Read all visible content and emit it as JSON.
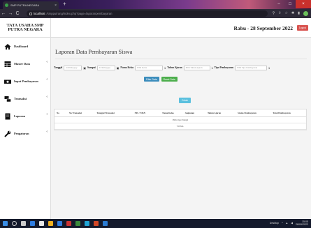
{
  "browser": {
    "tab_title": "SMP PUTRA NEGARA",
    "tab_close": "×",
    "new_tab": "+",
    "back": "←",
    "forward": "→",
    "reload": "C",
    "url_host": "localhost",
    "url_path": "/smpputrang/index.php?page=laporanpembayaran",
    "window_buttons": [
      "–",
      "□",
      "×"
    ]
  },
  "sidebar": {
    "brand": "TATA USAHA SMP PUTRA NEGARA",
    "items": [
      {
        "label": "Dashboard",
        "icon": "home-icon",
        "has_submenu": false
      },
      {
        "label": "Master Data",
        "icon": "table-icon",
        "has_submenu": true
      },
      {
        "label": "Input Pembayaran",
        "icon": "money-icon",
        "has_submenu": true
      },
      {
        "label": "Transaksi",
        "icon": "exchange-icon",
        "has_submenu": true
      },
      {
        "label": "Laporan",
        "icon": "book-icon",
        "has_submenu": true
      },
      {
        "label": "Pengaturan",
        "icon": "wrench-icon",
        "has_submenu": true
      }
    ],
    "chevron": "‹"
  },
  "header": {
    "date": "Rabu - 28 September 2022",
    "logout": "Logout"
  },
  "main": {
    "title": "Laporan Data Pembayaran Siswa",
    "filters": {
      "tanggal_label": "Tanggal",
      "tanggal_placeholder": "dd/mm/yyyy",
      "sampai_label": "Sampai",
      "sampai_placeholder": "dd/mm/yyyy",
      "kelas_label": "Nama Kelas",
      "kelas_value": "Pilih Kelas",
      "tahun_label": "Tahun Ajaran",
      "tahun_value": "Pilih Tahun Ajaran",
      "tipe_label": "Tipe Pembayaran",
      "tipe_value": "Pilih Tipe Pembayaran",
      "calendar_glyph": "▣",
      "dropdown_glyph": "▾"
    },
    "buttons": {
      "filter": "Filter Data",
      "reset": "Reset Data",
      "print": "Cetak"
    },
    "table": {
      "columns": [
        "No",
        "No Transaksi",
        "Tanggal Transaksi",
        "NIS / NISN",
        "Nama Kelas",
        "Angkatan",
        "Tahun Ajaran",
        "Status Pembayaran",
        "Total Pembayaran"
      ],
      "empty_message": "Pilih Opsi Tampil",
      "total_label": "TOTAL"
    }
  },
  "taskbar": {
    "desktop_label": "Desktop",
    "time": "15:05",
    "date": "28/09/2022",
    "icon_colors": [
      "#2f7de1",
      "#e8e8e8",
      "#f2b01e",
      "#2f7de1",
      "#c33",
      "#3b8a3b",
      "#1fa3d4",
      "#d24726",
      "#2b7cd3"
    ]
  }
}
